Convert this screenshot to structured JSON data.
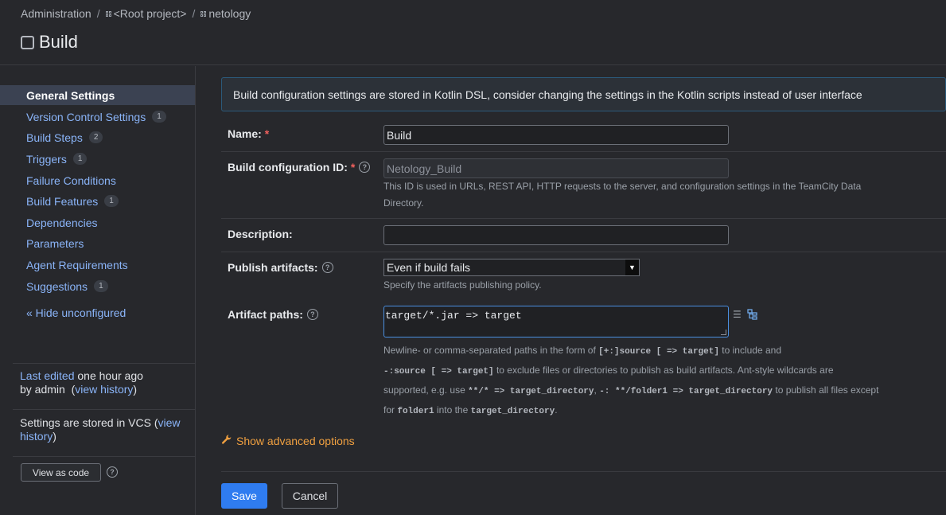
{
  "breadcrumb": {
    "admin": "Administration",
    "sep": "/",
    "root": "<Root project>",
    "project": "netology"
  },
  "page_title": "Build",
  "sidebar": {
    "items": [
      {
        "label": "General Settings",
        "badge": ""
      },
      {
        "label": "Version Control Settings",
        "badge": "1"
      },
      {
        "label": "Build Steps",
        "badge": "2"
      },
      {
        "label": "Triggers",
        "badge": "1"
      },
      {
        "label": "Failure Conditions",
        "badge": ""
      },
      {
        "label": "Build Features",
        "badge": "1"
      },
      {
        "label": "Dependencies",
        "badge": ""
      },
      {
        "label": "Parameters",
        "badge": ""
      },
      {
        "label": "Agent Requirements",
        "badge": ""
      },
      {
        "label": "Suggestions",
        "badge": "1"
      }
    ],
    "hide_unconfigured": "« Hide unconfigured",
    "last_edited_link": "Last edited",
    "last_edited_time": " one hour ago",
    "by_admin": "by admin",
    "view_history": "view history",
    "vcs_text": "Settings are stored in VCS (",
    "vcs_view_history": "view history",
    "vcs_close": ")",
    "view_as_code": "View as code"
  },
  "banner": "Build configuration settings are stored in Kotlin DSL, consider changing the settings in the Kotlin scripts instead of user interface",
  "form": {
    "name_label": "Name:",
    "name_value": "Build",
    "id_label": "Build configuration ID:",
    "id_value": "Netology_Build",
    "id_hint_1": "This ID is used in URLs, REST API, HTTP requests to the server, and configuration settings in the TeamCity Data",
    "id_hint_2": "Directory.",
    "description_label": "Description:",
    "description_value": "",
    "publish_label": "Publish artifacts:",
    "publish_value": "Even if build fails",
    "publish_hint": "Specify the artifacts publishing policy.",
    "artifact_label": "Artifact paths:",
    "artifact_value": "target/*.jar => target",
    "artifact_hint": {
      "t1": "Newline- or comma-separated paths in the form of ",
      "m1": "[+:]source [ => target]",
      "t2": " to include and",
      "m2": "-:source [ => target]",
      "t3": " to exclude files or directories to publish as build artifacts. Ant-style wildcards are",
      "t4": "supported, e.g. use ",
      "m3": "**/* => target_directory",
      "t5": ", ",
      "m4": "-: **/folder1 => target_directory",
      "t6": " to publish all files except",
      "t7": "for ",
      "m5": "folder1",
      "t8": " into the ",
      "m6": "target_directory",
      "t9": "."
    }
  },
  "advanced": "Show advanced options",
  "buttons": {
    "save": "Save",
    "cancel": "Cancel"
  },
  "colors": {
    "accent": "#2f7cf0",
    "link": "#8ab4f8",
    "required": "#f0605d",
    "advanced": "#f0a040"
  }
}
